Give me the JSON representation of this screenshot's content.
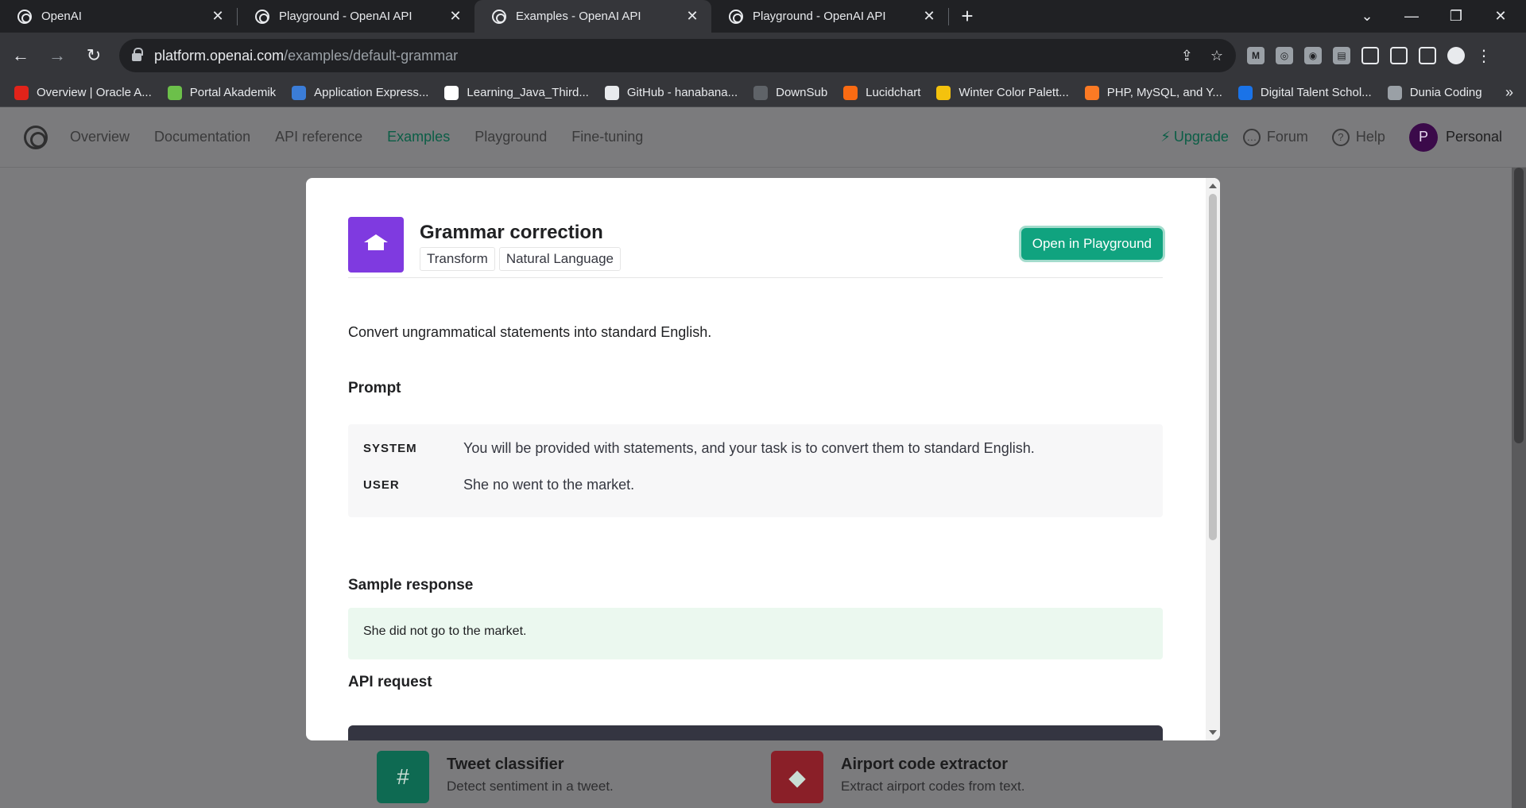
{
  "browser": {
    "tabs": [
      {
        "title": "OpenAI",
        "active": false
      },
      {
        "title": "Playground - OpenAI API",
        "active": false
      },
      {
        "title": "Examples - OpenAI API",
        "active": true
      },
      {
        "title": "Playground - OpenAI API",
        "active": false
      }
    ],
    "url_host": "platform.openai.com",
    "url_path": "/examples/default-grammar",
    "bookmarks": [
      {
        "label": "Overview | Oracle A...",
        "color": "#e2231a"
      },
      {
        "label": "Portal Akademik",
        "color": "#6cc04a"
      },
      {
        "label": "Application Express...",
        "color": "#3b7dd8"
      },
      {
        "label": "Learning_Java_Third...",
        "color": "#ffffff"
      },
      {
        "label": "GitHub - hanabana...",
        "color": "#e8eaed"
      },
      {
        "label": "DownSub",
        "color": "#5f6368"
      },
      {
        "label": "Lucidchart",
        "color": "#f96b13"
      },
      {
        "label": "Winter Color Palett...",
        "color": "#f4c20d"
      },
      {
        "label": "PHP, MySQL, and Y...",
        "color": "#fb7a24"
      },
      {
        "label": "Digital Talent Schol...",
        "color": "#1a73e8"
      },
      {
        "label": "Dunia Coding",
        "color": "#9aa0a6"
      }
    ],
    "more_bookmarks": "»"
  },
  "nav": {
    "links": [
      "Overview",
      "Documentation",
      "API reference",
      "Examples",
      "Playground",
      "Fine-tuning"
    ],
    "active": "Examples",
    "upgrade": "Upgrade",
    "forum": "Forum",
    "help": "Help",
    "avatar_letter": "P",
    "account": "Personal"
  },
  "example": {
    "title": "Grammar correction",
    "tags": [
      "Transform",
      "Natural Language"
    ],
    "open_button": "Open in Playground",
    "description": "Convert ungrammatical statements into standard English.",
    "prompt_heading": "Prompt",
    "prompt": [
      {
        "role": "SYSTEM",
        "content": "You will be provided with statements, and your task is to convert them to standard English."
      },
      {
        "role": "USER",
        "content": "She no went to the market."
      }
    ],
    "sample_heading": "Sample response",
    "sample_response": "She did not go to the market.",
    "api_heading": "API request"
  },
  "background_cards": [
    {
      "title": "Tweet classifier",
      "description": "Detect sentiment in a tweet.",
      "icon": "hash-icon",
      "color": "#0e6a52"
    },
    {
      "title": "Airport code extractor",
      "description": "Extract airport codes from text.",
      "icon": "tag-icon",
      "color": "#8a1f28"
    }
  ]
}
